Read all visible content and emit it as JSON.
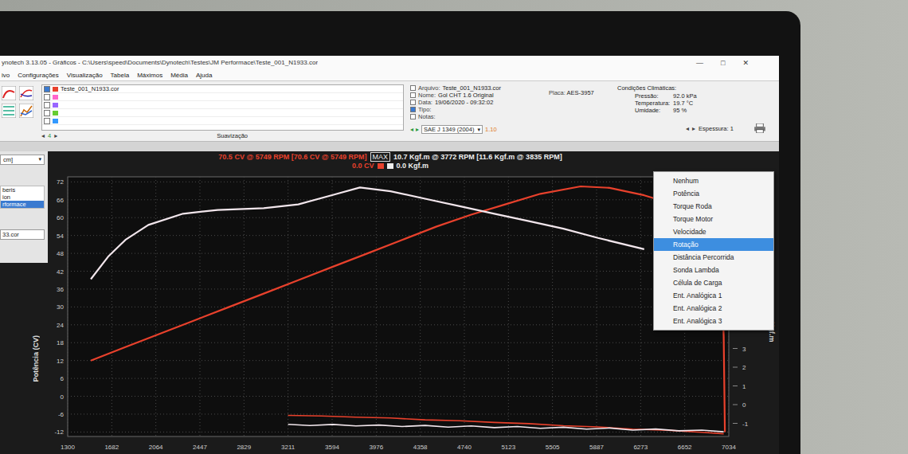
{
  "window": {
    "title": "ynotech 3.13.05 - Gráficos - C:\\Users\\speed\\Documents\\Dynotech\\Testes\\JM Performace\\Teste_001_N1933.cor",
    "controls": [
      "—",
      "□",
      "✕"
    ]
  },
  "menu": [
    "ivo",
    "Configurações",
    "Visualização",
    "Tabela",
    "Máximos",
    "Média",
    "Ajuda"
  ],
  "files": [
    {
      "name": "Teste_001_N1933.cor",
      "checked": true,
      "color": "#e8412c"
    },
    {
      "name": "",
      "checked": false,
      "color": "#ff66cc"
    },
    {
      "name": "",
      "checked": false,
      "color": "#9966ff"
    },
    {
      "name": "",
      "checked": false,
      "color": "#66cc33"
    },
    {
      "name": "",
      "checked": false,
      "color": "#3399ff"
    }
  ],
  "smoothing": {
    "prev": "◂",
    "value": "4",
    "next": "▸",
    "label": "Suavização"
  },
  "testInfo": [
    {
      "label": "Arquivo:",
      "value": "Teste_001_N1933.cor",
      "checked": false
    },
    {
      "label": "Nome:",
      "value": "Gol CHT 1.6 Original",
      "checked": false
    },
    {
      "label": "Data:",
      "value": "19/06/2020 - 09:32:02",
      "checked": false
    },
    {
      "label": "Tipo:",
      "value": "",
      "checked": true
    },
    {
      "label": "Notas:",
      "value": "",
      "checked": false
    }
  ],
  "plate": {
    "label": "Placa:",
    "value": "AES-3957"
  },
  "climate": {
    "title": "Condições Climáticas:",
    "rows": [
      {
        "label": "Pressão:",
        "value": "92.0 kPa"
      },
      {
        "label": "Temperatura:",
        "value": "19.7 °C"
      },
      {
        "label": "Umidade:",
        "value": "95 %"
      }
    ]
  },
  "correction": {
    "prev": "◂",
    "next": "▸",
    "standard": "SAE J 1349 (2004)",
    "arrow": "▾",
    "factor": "1.10"
  },
  "thickness": {
    "prev": "◂",
    "next": "▸",
    "label": "Espessura:",
    "value": "1"
  },
  "sidebar": {
    "select": "cm]",
    "arrow": "▾",
    "items": [
      {
        "label": "beris",
        "selected": false
      },
      {
        "label": "ion",
        "selected": false
      },
      {
        "label": "rformace",
        "selected": true
      }
    ],
    "file": "33.cor"
  },
  "chart": {
    "powerMax": "70.5 CV @ 5749 RPM [70.6 CV @ 5749 RPM]",
    "maxBadge": "MAX",
    "torqueMax": "10.7 Kgf.m @ 3772 RPM [11.6 Kgf.m @ 3835 RPM]",
    "powerCur": "0.0 CV",
    "torqueCur": "0.0 Kgf.m",
    "yLabel": "Potência (CV)",
    "y2Label": "Kgf.m",
    "yTicks": [
      "72",
      "66",
      "60",
      "54",
      "48",
      "42",
      "36",
      "30",
      "24",
      "18",
      "12",
      "6",
      "0",
      "-6",
      "-12"
    ],
    "y2Ticks": [
      "3",
      "2",
      "1",
      "0",
      "-1"
    ],
    "xTicks": [
      "1300",
      "1682",
      "2064",
      "2447",
      "2829",
      "3211",
      "3594",
      "3976",
      "4358",
      "4740",
      "5123",
      "5505",
      "5887",
      "6273",
      "6652",
      "7034"
    ],
    "series": [
      {
        "kind": "main",
        "axis": "left",
        "color": "#e8412c",
        "rpm": [
          1500,
          1800,
          2100,
          2400,
          2700,
          3000,
          3300,
          3600,
          3900,
          4200,
          4500,
          4800,
          5100,
          5400,
          5749,
          6000,
          6300,
          6600,
          6850,
          6960,
          6990,
          7000
        ],
        "values": [
          12,
          16.5,
          21,
          25.5,
          30,
          34.5,
          39,
          43.5,
          48,
          52.5,
          57,
          61,
          64.5,
          68,
          70.5,
          70,
          67.5,
          64,
          60,
          58,
          20,
          -12
        ]
      },
      {
        "kind": "main",
        "axis": "right",
        "color": "#f2e6ec",
        "rpm": [
          1500,
          1650,
          1800,
          2000,
          2300,
          2600,
          3000,
          3300,
          3600,
          3835,
          4100,
          4400,
          4700,
          5000,
          5300,
          5600,
          5900,
          6300
        ],
        "values": [
          6.7,
          7.9,
          8.8,
          9.6,
          10.2,
          10.4,
          10.5,
          10.7,
          11.2,
          11.6,
          11.4,
          11.0,
          10.6,
          10.2,
          9.8,
          9.4,
          8.9,
          8.3
        ]
      },
      {
        "kind": "loss",
        "axis": "left",
        "color": "#e8412c",
        "rpm": [
          3211,
          3500,
          3800,
          4100,
          4400,
          4700,
          5000,
          5300,
          5600,
          5900,
          6200,
          6500,
          6800,
          6990
        ],
        "values": [
          -6.4,
          -6.6,
          -7.0,
          -7.3,
          -7.9,
          -8.2,
          -8.8,
          -9.2,
          -9.9,
          -10.3,
          -11.0,
          -11.4,
          -12.1,
          -12.6
        ]
      },
      {
        "kind": "loss",
        "axis": "right",
        "color": "#f2e6ec",
        "rpm": [
          3211,
          3400,
          3600,
          3800,
          4000,
          4200,
          4400,
          4600,
          4800,
          5000,
          5200,
          5400,
          5600,
          5800,
          6000,
          6200,
          6400,
          6600,
          6800,
          6990
        ],
        "values": [
          -1.05,
          -1.12,
          -1.06,
          -1.14,
          -1.09,
          -1.17,
          -1.11,
          -1.2,
          -1.14,
          -1.23,
          -1.17,
          -1.27,
          -1.21,
          -1.31,
          -1.25,
          -1.36,
          -1.3,
          -1.4,
          -1.36,
          -1.45
        ]
      }
    ]
  },
  "contextMenu": {
    "items": [
      {
        "label": "Nenhum",
        "selected": false
      },
      {
        "label": "Potência",
        "selected": false
      },
      {
        "label": "Torque Roda",
        "selected": false
      },
      {
        "label": "Torque Motor",
        "selected": false
      },
      {
        "label": "Velocidade",
        "selected": false
      },
      {
        "label": "Rotação",
        "selected": true
      },
      {
        "label": "Distância Percorrida",
        "selected": false
      },
      {
        "label": "Sonda Lambda",
        "selected": false
      },
      {
        "label": "Célula de Carga",
        "selected": false
      },
      {
        "label": "Ent. Analógica 1",
        "selected": false
      },
      {
        "label": "Ent. Analógica 2",
        "selected": false
      },
      {
        "label": "Ent. Analógica 3",
        "selected": false
      }
    ]
  }
}
